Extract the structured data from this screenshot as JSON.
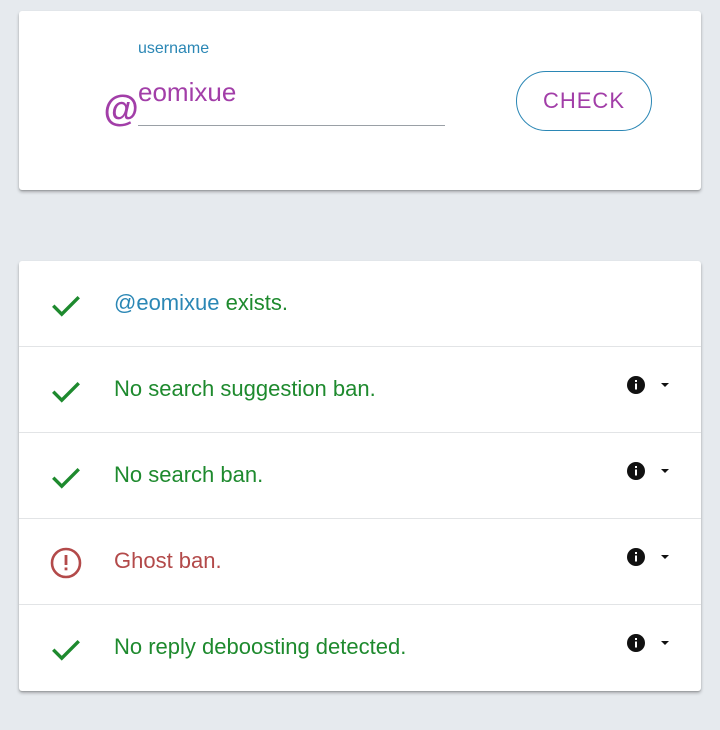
{
  "search": {
    "label": "username",
    "value": "eomixue",
    "at_symbol": "@",
    "button_label": "CHECK"
  },
  "results": [
    {
      "status": "ok",
      "icon": "check-icon",
      "handle": "@eomixue",
      "text": " exists.",
      "has_info": false
    },
    {
      "status": "ok",
      "icon": "check-icon",
      "text": "No search suggestion ban.",
      "has_info": true
    },
    {
      "status": "ok",
      "icon": "check-icon",
      "text": "No search ban.",
      "has_info": true
    },
    {
      "status": "bad",
      "icon": "alert-circle-icon",
      "text": "Ghost ban.",
      "has_info": true
    },
    {
      "status": "ok",
      "icon": "check-icon",
      "text": "No reply deboosting detected.",
      "has_info": true
    }
  ],
  "colors": {
    "accent_purple": "#a23ea8",
    "accent_blue": "#2b87b5",
    "ok_green": "#1e8a2e",
    "bad_red": "#b34a4a",
    "background": "#e6eaee"
  }
}
